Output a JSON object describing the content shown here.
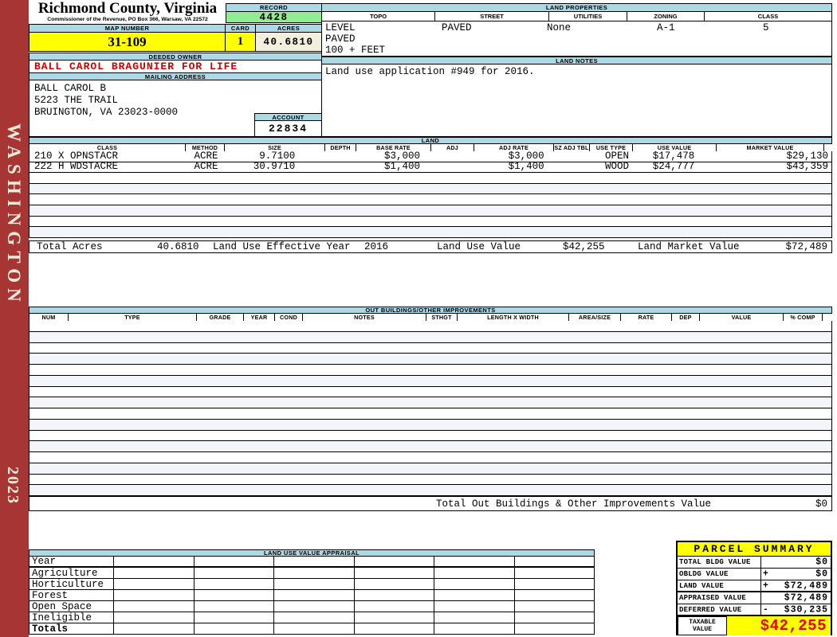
{
  "sidebar": {
    "district": "WASHINGTON",
    "year": "2023"
  },
  "header": {
    "county_title": "Richmond County, Virginia",
    "county_subtitle": "Commissioner of the Revenue, PO Box 366, Warsaw, VA 22572",
    "record_label": "RECORD",
    "record_value": "4428",
    "map_number_label": "MAP NUMBER",
    "map_number_value": "31-109",
    "card_label": "CARD",
    "card_value": "1",
    "acres_label": "ACRES",
    "acres_value": "40.6810",
    "deeded_owner_label": "DEEDED OWNER",
    "deeded_owner": "BALL CAROL BRAGUNIER FOR LIFE",
    "mailing_address_label": "MAILING ADDRESS",
    "mailing_lines": [
      "BALL CAROL B",
      "5223 THE TRAIL",
      "",
      "BRUINGTON, VA 23023-0000"
    ],
    "account_label": "ACCOUNT",
    "account_value": "22834"
  },
  "land_properties": {
    "title": "LAND PROPERTIES",
    "columns": [
      "TOPO",
      "STREET",
      "UTILITIES",
      "ZONING",
      "CLASS"
    ],
    "topo_lines": [
      "LEVEL",
      "PAVED",
      "100 + FEET"
    ],
    "street": "PAVED",
    "utilities": "None",
    "zoning": "A-1",
    "class": "5"
  },
  "land_notes": {
    "title": "LAND NOTES",
    "text": "Land use application #949 for 2016."
  },
  "land": {
    "title": "LAND",
    "columns": [
      "CLASS",
      "METHOD",
      "SIZE",
      "DEPTH",
      "BASE RATE",
      "ADJ",
      "ADJ RATE",
      "SZ ADJ TBL",
      "USE TYPE",
      "USE VALUE",
      "MARKET VALUE"
    ],
    "rows": [
      {
        "class": "210 X OPNSTACR",
        "method": "ACRE",
        "size": "9.7100",
        "depth": "",
        "base_rate": "$3,000",
        "adj": "",
        "adj_rate": "$3,000",
        "sz_adj_tbl": "",
        "use_type": "OPEN",
        "use_value": "$17,478",
        "market_value": "$29,130"
      },
      {
        "class": "222 H WDSTACRE",
        "method": "ACRE",
        "size": "30.9710",
        "depth": "",
        "base_rate": "$1,400",
        "adj": "",
        "adj_rate": "$1,400",
        "sz_adj_tbl": "",
        "use_type": "WOOD",
        "use_value": "$24,777",
        "market_value": "$43,359"
      }
    ],
    "empty_row_count": 6,
    "totals": {
      "total_acres_label": "Total Acres",
      "total_acres": "40.6810",
      "effective_year_label": "Land Use Effective Year",
      "effective_year": "2016",
      "use_value_label": "Land Use Value",
      "use_value": "$42,255",
      "market_value_label": "Land Market Value",
      "market_value": "$72,489"
    }
  },
  "out_buildings": {
    "title": "OUT BUILDINGS/OTHER IMPROVEMENTS",
    "columns": [
      "NUM",
      "TYPE",
      "GRADE",
      "YEAR",
      "COND",
      "NOTES",
      "STHGT",
      "LENGTH X WIDTH",
      "AREA/SIZE",
      "RATE",
      "DEP",
      "VALUE",
      "% COMP"
    ],
    "empty_row_count": 16,
    "total_label": "Total Out Buildings & Other Improvements Value",
    "total_value": "$0"
  },
  "land_use_appraisal": {
    "title": "LAND USE VALUE APPRAISAL",
    "row_labels": [
      "Year",
      "Agriculture",
      "Horticulture",
      "Forest",
      "Open Space",
      "Ineligible",
      "Totals"
    ],
    "column_count": 6
  },
  "parcel_summary": {
    "title": "PARCEL SUMMARY",
    "rows": [
      {
        "label": "TOTAL BLDG VALUE",
        "op": "",
        "value": "$0"
      },
      {
        "label": "OBLDG VALUE",
        "op": "+",
        "value": "$0"
      },
      {
        "label": "LAND VALUE",
        "op": "+",
        "value": "$72,489"
      },
      {
        "label": "APPRAISED VALUE",
        "op": "",
        "value": "$72,489"
      },
      {
        "label": "DEFERRED VALUE",
        "op": "-",
        "value": "$30,235"
      }
    ],
    "taxable_label": "TAXABLE\nVALUE",
    "taxable_value": "$42,255"
  },
  "colors": {
    "sidebar_red": "#A63534",
    "header_blue": "#ADD8E6",
    "record_green": "#90EE90",
    "field_yellow": "#FFFF00",
    "acres_beige": "#F2EFDC",
    "owner_red": "#CC0000",
    "taxable_red": "#EE0000",
    "row_stripe": "#F4F4FB"
  }
}
